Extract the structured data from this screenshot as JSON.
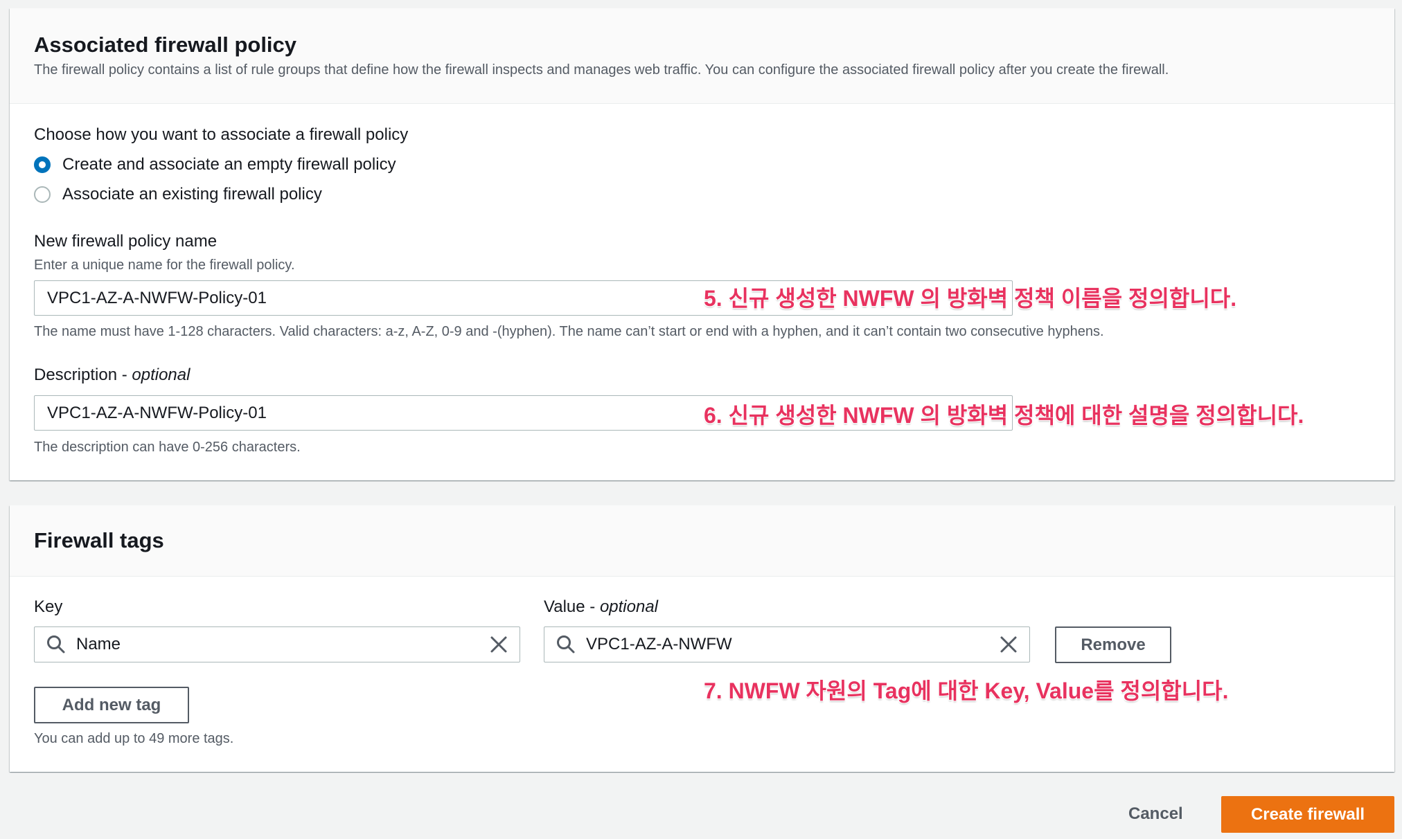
{
  "policy_panel": {
    "title": "Associated firewall policy",
    "description": "The firewall policy contains a list of rule groups that define how the firewall inspects and manages web traffic. You can configure the associated firewall policy after you create the firewall.",
    "choose_label": "Choose how you want to associate a firewall policy",
    "options": [
      {
        "label": "Create and associate an empty firewall policy",
        "selected": true
      },
      {
        "label": "Associate an existing firewall policy",
        "selected": false
      }
    ],
    "name_field": {
      "label": "New firewall policy name",
      "hint": "Enter a unique name for the firewall policy.",
      "value": "VPC1-AZ-A-NWFW-Policy-01",
      "constraint": "The name must have 1-128 characters. Valid characters: a-z, A-Z, 0-9 and -(hyphen). The name can’t start or end with a hyphen, and it can’t contain two consecutive hyphens."
    },
    "description_field": {
      "label": "Description - ",
      "label_optional": "optional",
      "value": "VPC1-AZ-A-NWFW-Policy-01",
      "constraint": "The description can have 0-256 characters."
    }
  },
  "tags_panel": {
    "title": "Firewall tags",
    "key_label": "Key",
    "value_label": "Value - ",
    "value_label_optional": "optional",
    "key_value": "Name",
    "value_value": "VPC1-AZ-A-NWFW",
    "remove_button": "Remove",
    "add_button": "Add new tag",
    "add_hint": "You can add up to 49 more tags."
  },
  "footer": {
    "cancel": "Cancel",
    "create": "Create firewall"
  },
  "annotations": {
    "step5": "5. 신규 생성한 NWFW 의 방화벽 정책 이름을 정의합니다.",
    "step6": "6. 신규 생성한 NWFW 의 방화벽 정책에 대한 설명을 정의합니다.",
    "step7": "7. NWFW 자원의 Tag에 대한 Key, Value를 정의합니다."
  },
  "colors": {
    "primary_button": "#ec7211",
    "radio_selected": "#0073bb",
    "annotation": "#e8325f"
  }
}
